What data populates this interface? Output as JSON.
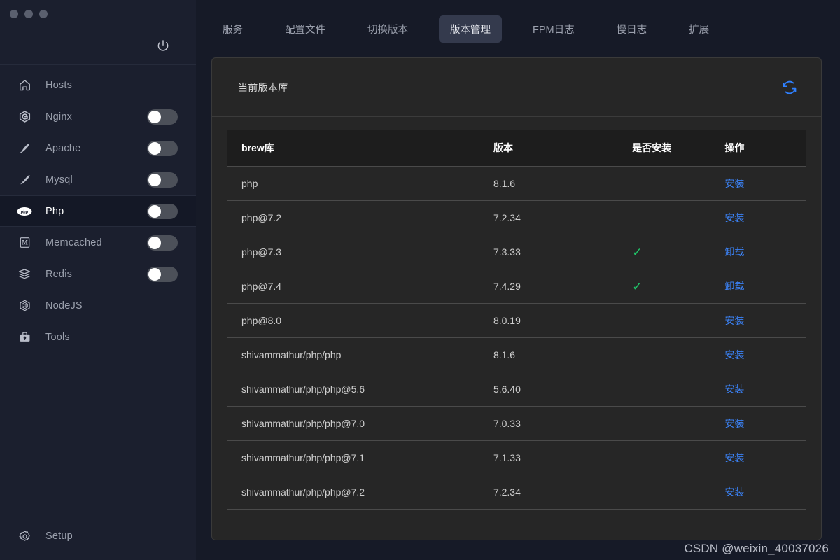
{
  "window": {
    "controls": [
      "close",
      "minimize",
      "maximize"
    ]
  },
  "sidebar": {
    "power_icon": "power-icon",
    "items": [
      {
        "label": "Hosts",
        "icon": "home-icon",
        "toggle": false,
        "active": false,
        "has_toggle": false
      },
      {
        "label": "Nginx",
        "icon": "nginx-icon",
        "toggle": false,
        "active": false,
        "has_toggle": true
      },
      {
        "label": "Apache",
        "icon": "apache-icon",
        "toggle": false,
        "active": false,
        "has_toggle": true
      },
      {
        "label": "Mysql",
        "icon": "mysql-icon",
        "toggle": false,
        "active": false,
        "has_toggle": true
      },
      {
        "label": "Php",
        "icon": "php-icon",
        "toggle": false,
        "active": true,
        "has_toggle": true
      },
      {
        "label": "Memcached",
        "icon": "memcached-icon",
        "toggle": false,
        "active": false,
        "has_toggle": true
      },
      {
        "label": "Redis",
        "icon": "redis-icon",
        "toggle": false,
        "active": false,
        "has_toggle": true
      },
      {
        "label": "NodeJS",
        "icon": "nodejs-icon",
        "toggle": false,
        "active": false,
        "has_toggle": false
      },
      {
        "label": "Tools",
        "icon": "tools-icon",
        "toggle": false,
        "active": false,
        "has_toggle": false
      }
    ],
    "setup": {
      "label": "Setup",
      "icon": "gear-icon"
    }
  },
  "tabs": [
    {
      "label": "服务",
      "active": false
    },
    {
      "label": "配置文件",
      "active": false
    },
    {
      "label": "切换版本",
      "active": false
    },
    {
      "label": "版本管理",
      "active": true
    },
    {
      "label": "FPM日志",
      "active": false
    },
    {
      "label": "慢日志",
      "active": false
    },
    {
      "label": "扩展",
      "active": false
    }
  ],
  "panel": {
    "title": "当前版本库",
    "refresh_icon": "refresh-icon"
  },
  "table": {
    "columns": [
      "brew库",
      "版本",
      "是否安装",
      "操作"
    ],
    "rows": [
      {
        "name": "php",
        "version": "8.1.6",
        "installed": false,
        "action": "安装"
      },
      {
        "name": "php@7.2",
        "version": "7.2.34",
        "installed": false,
        "action": "安装"
      },
      {
        "name": "php@7.3",
        "version": "7.3.33",
        "installed": true,
        "action": "卸载"
      },
      {
        "name": "php@7.4",
        "version": "7.4.29",
        "installed": true,
        "action": "卸载"
      },
      {
        "name": "php@8.0",
        "version": "8.0.19",
        "installed": false,
        "action": "安装"
      },
      {
        "name": "shivammathur/php/php",
        "version": "8.1.6",
        "installed": false,
        "action": "安装"
      },
      {
        "name": "shivammathur/php/php@5.6",
        "version": "5.6.40",
        "installed": false,
        "action": "安装"
      },
      {
        "name": "shivammathur/php/php@7.0",
        "version": "7.0.33",
        "installed": false,
        "action": "安装"
      },
      {
        "name": "shivammathur/php/php@7.1",
        "version": "7.1.33",
        "installed": false,
        "action": "安装"
      },
      {
        "name": "shivammathur/php/php@7.2",
        "version": "7.2.34",
        "installed": false,
        "action": "安装"
      }
    ],
    "check_glyph": "✓"
  },
  "watermark": "CSDN @weixin_40037026",
  "colors": {
    "sidebar_bg": "#1b1f2e",
    "content_bg": "#161a27",
    "card_bg": "#262626",
    "accent_blue": "#3b82f6",
    "refresh_blue": "#2f80ff",
    "check_green": "#1fc86a",
    "active_tab_bg": "#343a4d"
  }
}
